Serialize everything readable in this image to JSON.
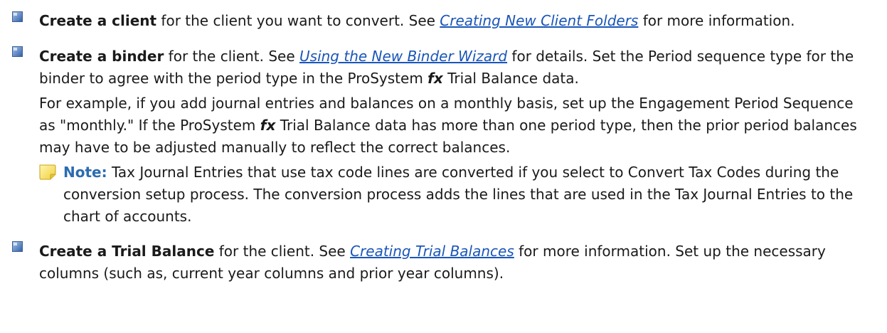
{
  "items": [
    {
      "lead": "Create a client",
      "t1": " for the client you want to convert. See ",
      "link": "Creating New Client Folders",
      "t2": " for more information."
    },
    {
      "lead": "Create a binder",
      "t1": " for the client. See ",
      "link": "Using the New Binder Wizard",
      "t2": " for details. Set the Period sequence type for the binder to agree with the period type in the ProSystem ",
      "fx": "fx",
      "t3": " Trial Balance data.",
      "para2_a": "For example, if you add journal entries and balances on a monthly basis, set up the Engagement Period Sequence as \"monthly.\" If the ProSystem ",
      "para2_fx": "fx",
      "para2_b": " Trial Balance data has more than one period type, then the prior period balances may have to be adjusted manually to reflect the correct balances.",
      "note_label": "Note:",
      "note_text": " Tax Journal Entries that use tax code lines are converted if you select to Convert Tax Codes during the conversion setup process. The conversion process adds the lines that are used in the Tax Journal Entries to the chart of accounts."
    },
    {
      "lead": "Create a Trial Balance",
      "t1": " for the client. See ",
      "link": "Creating Trial Balances",
      "t2": " for more information. Set up the necessary columns (such as, current year columns and prior year columns)."
    }
  ],
  "colors": {
    "link": "#1a56b8",
    "note_label": "#2b6cb0",
    "bullet": "#2f5fa8"
  },
  "icons": {
    "bullet": "square-bullet-icon",
    "note": "note-icon"
  }
}
